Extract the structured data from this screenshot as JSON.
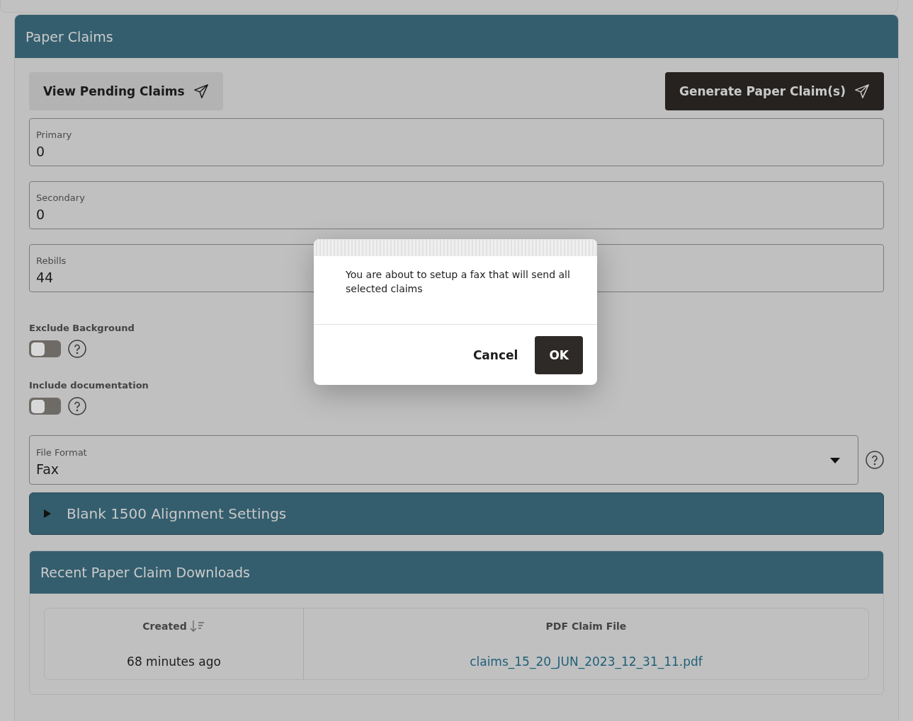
{
  "panel": {
    "title": "Paper Claims"
  },
  "buttons": [
    {
      "label": "View Pending Claims",
      "kind": "secondary"
    },
    {
      "label": "Generate Paper Claim(s)",
      "kind": "primary"
    }
  ],
  "fields": [
    {
      "label": "Primary",
      "value": "0"
    },
    {
      "label": "Secondary",
      "value": "0"
    },
    {
      "label": "Rebills",
      "value": "44"
    }
  ],
  "toggles": [
    {
      "label": "Exclude Background",
      "on": false
    },
    {
      "label": "Include documentation",
      "on": false
    }
  ],
  "file_format": {
    "label": "File Format",
    "value": "Fax"
  },
  "alignment_section": {
    "title": "Blank 1500 Alignment Settings",
    "expanded": false
  },
  "downloads": {
    "title": "Recent Paper Claim Downloads",
    "columns": [
      {
        "label": "Created",
        "sorted": true
      },
      {
        "label": "PDF Claim File",
        "sorted": false
      }
    ],
    "rows": [
      {
        "created": "68 minutes ago",
        "file": "claims_15_20_JUN_2023_12_31_11.pdf"
      }
    ]
  },
  "dialog": {
    "message": "You are about to setup a fax that will send all selected claims",
    "buttons": [
      {
        "label": "Cancel",
        "kind": "secondary"
      },
      {
        "label": "OK",
        "kind": "primary"
      }
    ]
  }
}
